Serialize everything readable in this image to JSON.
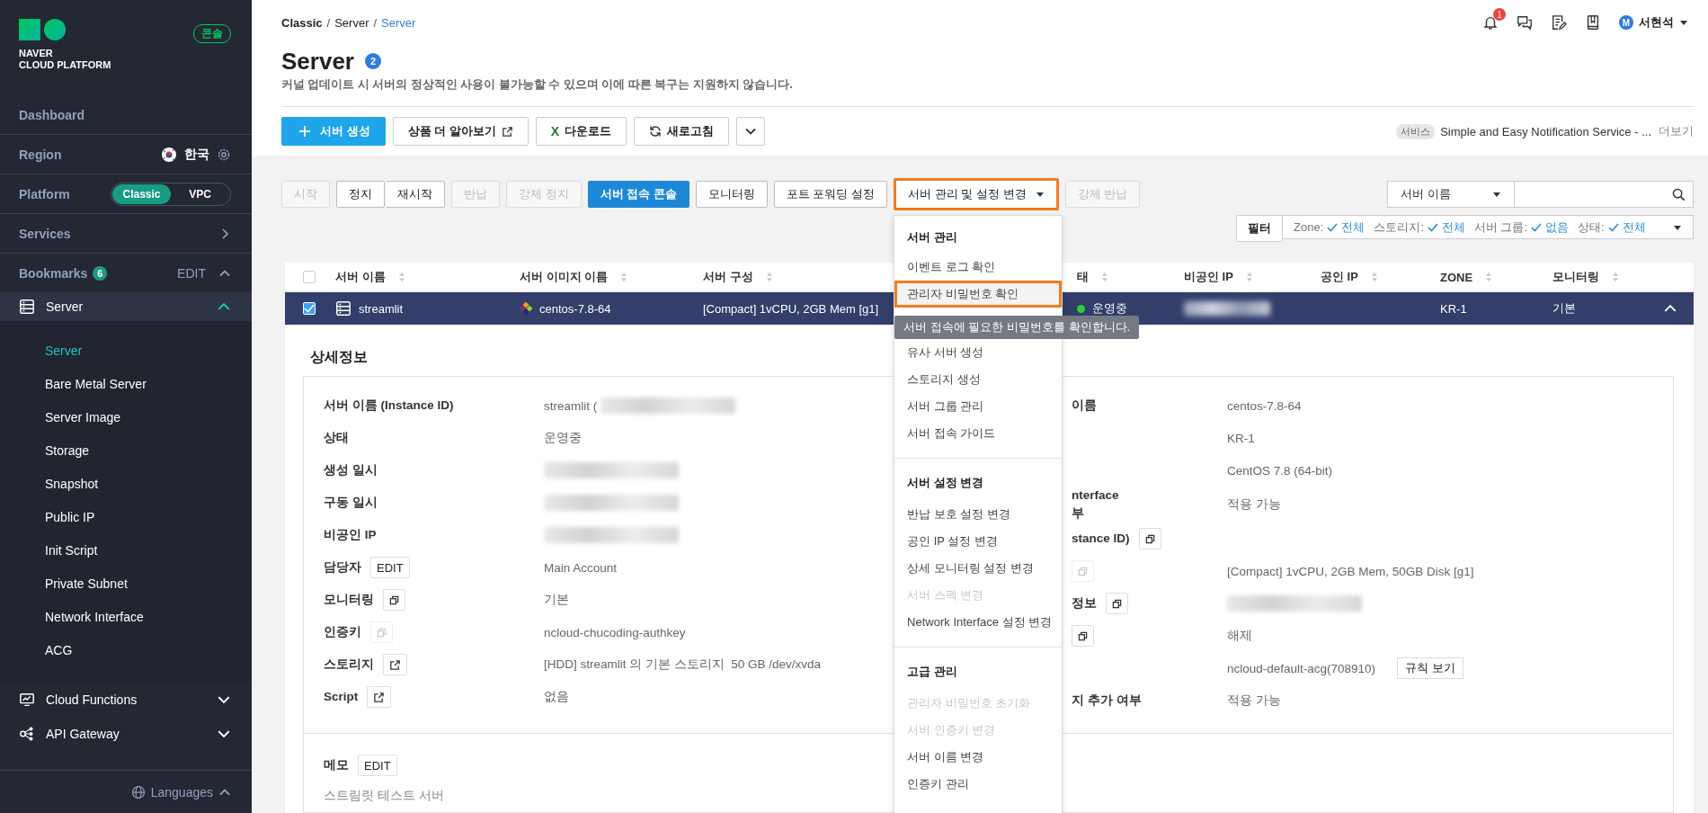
{
  "sidebar": {
    "logo": {
      "line_1": "NAVER",
      "line_2": "CLOUD PLATFORM"
    },
    "console_link": "콘솔",
    "rows": [
      {
        "kind": "link",
        "label": "Dashboard"
      },
      {
        "kind": "region",
        "label": "Region",
        "value": "한국"
      },
      {
        "kind": "platform",
        "label": "Platform",
        "options": [
          {
            "label": "Classic",
            "selected": true
          },
          {
            "label": "VPC",
            "selected": false
          }
        ]
      },
      {
        "kind": "services",
        "label": "Services"
      },
      {
        "kind": "bookmarks",
        "label": "Bookmarks",
        "count": "6",
        "action": "EDIT",
        "expanded": true
      }
    ],
    "menu": [
      {
        "label": "Server",
        "expanded": true,
        "children": [
          {
            "label": "Server",
            "selected": true
          },
          {
            "label": "Bare Metal Server",
            "selected": false
          },
          {
            "label": "Server Image",
            "selected": false
          },
          {
            "label": "Storage",
            "selected": false
          },
          {
            "label": "Snapshot",
            "selected": false
          },
          {
            "label": "Public IP",
            "selected": false
          },
          {
            "label": "Init Script",
            "selected": false
          },
          {
            "label": "Private Subnet",
            "selected": false
          },
          {
            "label": "Network Interface",
            "selected": false
          },
          {
            "label": "ACG",
            "selected": false
          }
        ]
      },
      {
        "label": "Cloud Functions",
        "expanded": false
      },
      {
        "label": "API Gateway",
        "expanded": false
      }
    ],
    "languages": "Languages"
  },
  "header": {
    "breadcrumb": [
      {
        "kind": "root",
        "label": "Classic"
      },
      {
        "kind": "link",
        "label": "Server"
      },
      {
        "kind": "current",
        "label": "Server"
      }
    ],
    "breadcrumb_separator": "/",
    "notifications": "1",
    "user": {
      "initial": "M",
      "name": "서현석"
    }
  },
  "page": {
    "title": "Server",
    "count": "2",
    "notice": "커널 업데이트 시 서버의 정상적인 사용이 불가능할 수 있으며 이에 따른 복구는 지원하지 않습니다."
  },
  "toolbar": {
    "buttons": [
      {
        "kind": "primary",
        "label": "서버 생성"
      },
      {
        "kind": "external",
        "label": "상품 더 알아보기"
      },
      {
        "kind": "excel",
        "icon": "X",
        "label": "다운로드"
      },
      {
        "kind": "refresh",
        "label": "새로고침"
      },
      {
        "kind": "more"
      }
    ],
    "service_tag": "서비스",
    "service_text": "Simple and Easy Notification Service - ...",
    "more_link": "더보기"
  },
  "actions": [
    {
      "kind": "normal",
      "label": "시작",
      "disabled": true,
      "joined": false
    },
    {
      "kind": "normal",
      "label": "정지",
      "disabled": false,
      "joined": false
    },
    {
      "kind": "normal",
      "label": "재시작",
      "disabled": false,
      "joined": true
    },
    {
      "kind": "normal",
      "label": "반납",
      "disabled": true,
      "joined": false
    },
    {
      "kind": "normal",
      "label": "강제 정지",
      "disabled": true,
      "joined": false
    },
    {
      "kind": "primary",
      "label": "서버 접속 콘솔",
      "disabled": false,
      "joined": false
    },
    {
      "kind": "normal",
      "label": "모니터링",
      "disabled": false,
      "joined": false
    },
    {
      "kind": "normal",
      "label": "포트 포워딩 설정",
      "disabled": false,
      "joined": false
    },
    {
      "kind": "menu",
      "label": "서버 관리 및 설정 변경",
      "disabled": false,
      "joined": false,
      "expanded": true,
      "highlighted": true
    },
    {
      "kind": "normal",
      "label": "강제 반납",
      "disabled": true,
      "joined": false
    }
  ],
  "search": {
    "select": "서버 이름"
  },
  "filter": {
    "button": "필터",
    "conditions": [
      {
        "label": "Zone:",
        "value": "전체"
      },
      {
        "label": "스토리지:",
        "value": "전체"
      },
      {
        "label": "서버 그룹:",
        "value": "없음"
      },
      {
        "label": "상태:",
        "value": "전체"
      }
    ]
  },
  "menu": {
    "sections": [
      {
        "title": "서버 관리",
        "items": [
          {
            "label": "이벤트 로그 확인",
            "disabled": false,
            "highlighted": false
          },
          {
            "label": "관리자 비밀번호 확인",
            "disabled": false,
            "highlighted": true,
            "tooltip": "서버 접속에 필요한 비밀번호를 확인합니다."
          },
          {
            "label": "유사 서버 생성",
            "disabled": false,
            "highlighted": false
          },
          {
            "label": "스토리지 생성",
            "disabled": false,
            "highlighted": false
          },
          {
            "label": "서버 그룹 관리",
            "disabled": false,
            "highlighted": false
          },
          {
            "label": "서버 접속 가이드",
            "disabled": false,
            "highlighted": false
          }
        ]
      },
      {
        "title": "서버 설정 변경",
        "items": [
          {
            "label": "반납 보호 설정 변경",
            "disabled": false,
            "highlighted": false
          },
          {
            "label": "공인 IP 설정 변경",
            "disabled": false,
            "highlighted": false
          },
          {
            "label": "상세 모니터링 설정 변경",
            "disabled": false,
            "highlighted": false
          },
          {
            "label": "서버 스펙 변경",
            "disabled": true,
            "highlighted": false
          },
          {
            "label": "Network Interface 설정 변경",
            "disabled": false,
            "highlighted": false
          }
        ]
      },
      {
        "title": "고급 관리",
        "items": [
          {
            "label": "관리자 비밀번호 초기화",
            "disabled": true,
            "highlighted": false
          },
          {
            "label": "서버 인증키 변경",
            "disabled": true,
            "highlighted": false
          },
          {
            "label": "서버 이름 변경",
            "disabled": false,
            "highlighted": false
          },
          {
            "label": "인증키 관리",
            "disabled": false,
            "highlighted": false
          }
        ]
      }
    ]
  },
  "table": {
    "header_checked": false,
    "columns": [
      "서버 이름",
      "서버 이미지 이름",
      "서버 구성",
      "태",
      "비공인 IP",
      "공인 IP",
      "ZONE",
      "모니터링"
    ],
    "rows": [
      {
        "selected": true,
        "checked": true,
        "expanded": true,
        "name": "streamlit",
        "image": "centos-7.8-64",
        "spec": "[Compact] 1vCPU, 2GB Mem [g1]",
        "status": "운영중",
        "private_ip_blurred": true,
        "zone": "KR-1",
        "monitoring": "기본"
      }
    ]
  },
  "detail": {
    "title": "상세정보",
    "left": [
      {
        "label": "서버 이름 (Instance ID)",
        "value": "streamlit (",
        "blurred": true
      },
      {
        "label": "상태",
        "value": "운영중"
      },
      {
        "label": "생성 일시",
        "blurred": true
      },
      {
        "label": "구동 일시",
        "blurred": true
      },
      {
        "label": "비공인 IP",
        "blurred": true
      },
      {
        "label": "담당자",
        "action": {
          "kind": "edit",
          "label": "EDIT",
          "disabled": false
        },
        "value": "Main Account"
      },
      {
        "label": "모니터링",
        "action": {
          "kind": "copy",
          "disabled": false
        },
        "value": "기본"
      },
      {
        "label": "인증키",
        "action": {
          "kind": "copy",
          "disabled": true
        },
        "value": "ncloud-chucoding-authkey"
      },
      {
        "label": "스토리지",
        "action": {
          "kind": "link",
          "disabled": false
        },
        "value": "[HDD] streamlit 의 기본 스토리지  50 GB /dev/xvda"
      },
      {
        "label": "Script",
        "action": {
          "kind": "link",
          "disabled": false
        },
        "value": "없음"
      }
    ],
    "right": [
      {
        "label": "이름",
        "value": "centos-7.8-64"
      },
      {
        "value": "KR-1"
      },
      {
        "value": "CentOS 7.8 (64-bit)"
      },
      {
        "label": "nterface\n부",
        "value": "적용 가능"
      },
      {
        "label": "stance ID)",
        "action": {
          "kind": "copy",
          "disabled": false
        }
      },
      {
        "action": {
          "kind": "copy",
          "disabled": true
        },
        "value": "[Compact] 1vCPU, 2GB Mem, 50GB Disk [g1]"
      },
      {
        "label": "정보",
        "action": {
          "kind": "copy",
          "disabled": false
        },
        "blurred": true
      },
      {
        "action": {
          "kind": "copy",
          "disabled": false
        },
        "value": "해제"
      },
      {
        "value": "ncloud-default-acg(708910)",
        "button": "규칙 보기"
      },
      {
        "label": "지 추가 여부",
        "value": "적용 가능"
      }
    ],
    "memo": {
      "label": "메모",
      "action": {
        "kind": "edit",
        "label": "EDIT",
        "disabled": false
      },
      "text": "스트림릿 테스트 서버"
    }
  }
}
